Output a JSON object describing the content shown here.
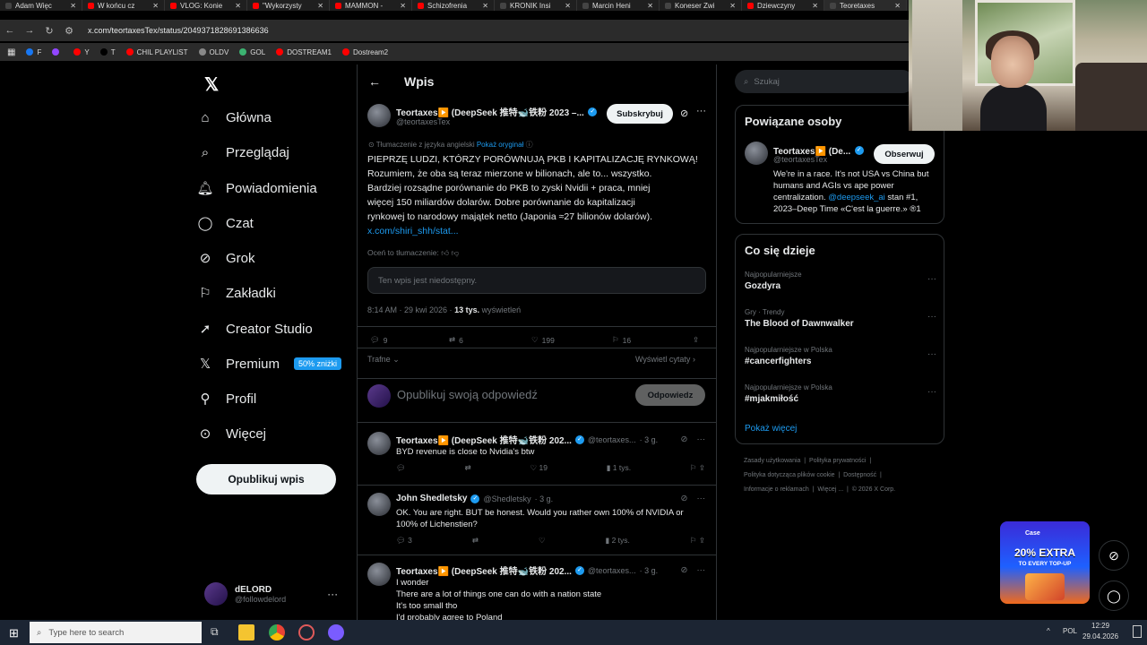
{
  "browser": {
    "tabs": [
      {
        "title": "Adam Więc",
        "color": "#444"
      },
      {
        "title": "W końcu cz",
        "color": "#ff0000"
      },
      {
        "title": "VLOG: Konie",
        "color": "#ff0000"
      },
      {
        "title": "\"Wykorzysty",
        "color": "#ff0000"
      },
      {
        "title": "MAMMON -",
        "color": "#ff0000"
      },
      {
        "title": "Schizofrenia",
        "color": "#ff0000"
      },
      {
        "title": "KRONIK Insi",
        "color": "#444"
      },
      {
        "title": "Marcin Heni",
        "color": "#444"
      },
      {
        "title": "Koneser Zwi",
        "color": "#444"
      },
      {
        "title": "Dziewczyny",
        "color": "#ff0000"
      },
      {
        "title": "Teoretaxes",
        "color": "#444"
      }
    ],
    "url": "x.com/teortaxesTex/status/2049371828691386636",
    "bookmarks": [
      {
        "label": "F",
        "color": "#1877f2"
      },
      {
        "label": "",
        "color": "#9146ff"
      },
      {
        "label": "Y",
        "color": "#ff0000"
      },
      {
        "label": "T",
        "color": "#000"
      },
      {
        "label": "CHIL PLAYLIST",
        "color": "#ff0000"
      },
      {
        "label": "OLDV",
        "color": "#888"
      },
      {
        "label": "GOL",
        "color": "#3cb371"
      },
      {
        "label": "DOSTREAM1",
        "color": "#ff0000"
      },
      {
        "label": "Dostream2",
        "color": "#ff0000"
      }
    ]
  },
  "nav": {
    "items": [
      {
        "label": "Główna",
        "icon": "home-icon"
      },
      {
        "label": "Przeglądaj",
        "icon": "search-icon"
      },
      {
        "label": "Powiadomienia",
        "icon": "bell-icon"
      },
      {
        "label": "Czat",
        "icon": "chat-icon"
      },
      {
        "label": "Grok",
        "icon": "grok-icon"
      },
      {
        "label": "Zakładki",
        "icon": "bookmark-icon"
      },
      {
        "label": "Creator Studio",
        "icon": "rocket-icon"
      },
      {
        "label": "Premium",
        "icon": "x-icon"
      },
      {
        "label": "Profil",
        "icon": "person-icon"
      },
      {
        "label": "Więcej",
        "icon": "more-icon"
      }
    ],
    "premium_badge": "50% zniżki",
    "publish_button": "Opublikuj wpis",
    "account": {
      "name": "dELORD",
      "handle": "@followdelord"
    }
  },
  "post": {
    "header_title": "Wpis",
    "author_name": "Teortaxes▶️ (DeepSeek 推特🐋铁粉 2023 –...",
    "author_handle": "@teortaxesTex",
    "subscribe_label": "Subskrybuj",
    "translated_note": "Tłumaczenie z języka angielski",
    "show_original": "Pokaż oryginał",
    "body_lines": [
      "PIEPRZĘ LUDZI, KTÓRZY PORÓWNUJĄ PKB I KAPITALIZACJĘ RYNKOWĄ!",
      "Rozumiem, że oba są teraz mierzone w bilionach, ale to... wszystko.",
      "Bardziej rozsądne porównanie do PKB to zyski Nvidii + praca, mniej",
      "więcej 150 miliardów dolarów. Dobre porównanie do kapitalizacji",
      "rynkowej to narodowy majątek netto (Japonia ≈27 bilionów dolarów)."
    ],
    "body_link": "x.com/shiri_shh/stat...",
    "rate_translation": "Oceń to tłumaczenie:",
    "unavailable": "Ten wpis jest niedostępny.",
    "timestamp": "8:14 AM · 29 kwi 2026 ·",
    "views_count": "13 tys.",
    "views_label": "wyświetleń",
    "stats": {
      "replies": "9",
      "reposts": "6",
      "likes": "199",
      "bookmarks": "16"
    },
    "sort_label": "Trafne",
    "show_quotes": "Wyświetl cytaty",
    "reply_placeholder": "Opublikuj swoją odpowiedź",
    "reply_button": "Odpowiedz"
  },
  "replies": [
    {
      "name": "Teortaxes▶️ (DeepSeek 推特🐋铁粉 202...",
      "handle": "@teortaxes...",
      "time": "· 3 g.",
      "lines": [
        "BYD revenue is close to Nvidia's btw"
      ],
      "replies": "",
      "likes": "19",
      "views": "1 tys."
    },
    {
      "name": "John Shedletsky",
      "handle": "@Shedletsky",
      "time": "· 3 g.",
      "lines": [
        "OK. You are right. BUT be honest. Would you rather own 100% of NVIDIA or",
        "100% of Lichenstien?"
      ],
      "replies": "3",
      "likes": "",
      "views": "2 tys."
    },
    {
      "name": "Teortaxes▶️ (DeepSeek 推特🐋铁粉 202...",
      "handle": "@teortaxes...",
      "time": "· 3 g.",
      "lines": [
        "I wonder",
        "There are a lot of things one can do with a nation state",
        "It's too small tho",
        "I'd probably agree to Poland"
      ],
      "replies": "",
      "likes": "",
      "views": ""
    }
  ],
  "right": {
    "search_placeholder": "Szukaj",
    "related_title": "Powiązane osoby",
    "related": {
      "name": "Teortaxes▶️ (De...",
      "handle": "@teortaxesTex",
      "follow_label": "Obserwuj",
      "bio_parts": [
        "We're in a race. It's not USA vs China but humans and AGIs vs ape power centralization. ",
        "@deepseek_ai",
        " stan #1, 2023–Deep Time «C'est la guerre.» ®1"
      ]
    },
    "trends_title": "Co się dzieje",
    "trends": [
      {
        "category": "Najpopularniejsze",
        "name": "Gozdyra"
      },
      {
        "category": "Gry · Trendy",
        "name": "The Blood of Dawnwalker"
      },
      {
        "category": "Najpopularniejsze w Polska",
        "name": "#cancerfighters"
      },
      {
        "category": "Najpopularniejsze w Polska",
        "name": "#mjakmiłość"
      }
    ],
    "show_more": "Pokaż więcej",
    "footer_line1": [
      "Zasady użytkowania",
      "Polityka prywatności"
    ],
    "footer_line2": [
      "Polityka dotycząca plików cookie",
      "Dostępność"
    ],
    "footer_line3": [
      "Informacje o reklamach",
      "Więcej ...",
      "© 2026 X Corp."
    ]
  },
  "ad": {
    "brand": "Case",
    "headline": "20% EXTRA",
    "sub": "TO EVERY TOP-UP"
  },
  "taskbar": {
    "search_placeholder": "Type here to search",
    "language": "POL",
    "time": "12:29",
    "date": "29.04.2026"
  },
  "colors": {
    "accent": "#1d9bf0",
    "background": "#000000",
    "border": "#2f3336",
    "muted": "#71767b"
  }
}
